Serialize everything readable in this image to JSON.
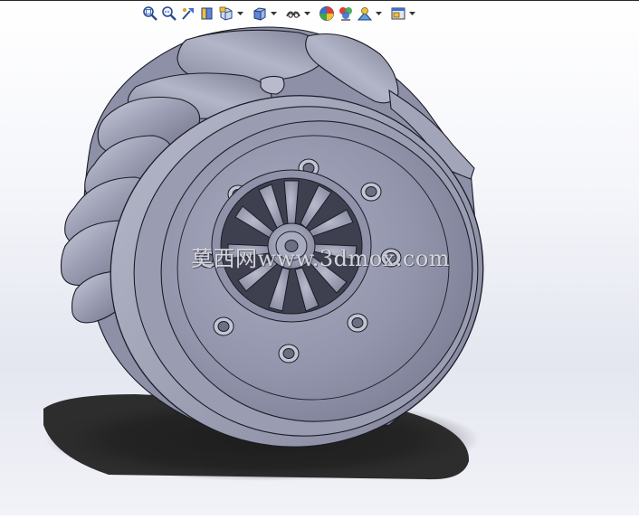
{
  "watermark": {
    "text": "莫西网www.3dmox.com"
  },
  "heads_up_toolbar": {
    "items": [
      {
        "name": "zoom-to-fit-icon",
        "has_dropdown": false
      },
      {
        "name": "zoom-to-area-icon",
        "has_dropdown": false
      },
      {
        "name": "previous-view-icon",
        "has_dropdown": false
      },
      {
        "name": "section-view-icon",
        "has_dropdown": false
      },
      {
        "name": "dynamic-annotation-views-icon",
        "has_dropdown": true
      },
      {
        "name": "view-orientation-icon",
        "has_dropdown": true
      },
      {
        "name": "display-style-icon",
        "has_dropdown": true
      },
      {
        "name": "hide-show-items-icon",
        "has_dropdown": false
      },
      {
        "name": "edit-appearance-icon",
        "has_dropdown": false
      },
      {
        "name": "apply-scene-icon",
        "has_dropdown": true
      },
      {
        "name": "view-settings-icon",
        "has_dropdown": true
      }
    ]
  },
  "colors": {
    "part_body": "#9c9fb4",
    "part_dark": "#6c6f84",
    "part_light": "#c7c9d8",
    "edge_line": "#1c1c26",
    "shadow": "#1b1b1b",
    "accent_blue": "#3b6fd0"
  }
}
